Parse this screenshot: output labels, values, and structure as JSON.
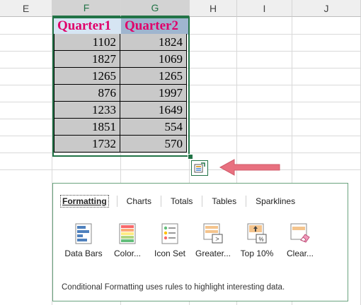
{
  "columns": {
    "E": "E",
    "F": "F",
    "G": "G",
    "H": "H",
    "I": "I",
    "J": "J"
  },
  "table": {
    "headers": [
      "Quarter1",
      "Quarter2"
    ],
    "rows": [
      [
        "1102",
        "1824"
      ],
      [
        "1827",
        "1069"
      ],
      [
        "1265",
        "1265"
      ],
      [
        "876",
        "1997"
      ],
      [
        "1233",
        "1649"
      ],
      [
        "1851",
        "554"
      ],
      [
        "1732",
        "570"
      ]
    ]
  },
  "quick_analysis": {
    "tabs": [
      "Formatting",
      "Charts",
      "Totals",
      "Tables",
      "Sparklines"
    ],
    "active_tab": "Formatting",
    "options": [
      {
        "label": "Data Bars",
        "icon": "data-bars-icon"
      },
      {
        "label": "Color...",
        "icon": "color-scale-icon"
      },
      {
        "label": "Icon Set",
        "icon": "icon-set-icon"
      },
      {
        "label": "Greater...",
        "icon": "greater-than-icon"
      },
      {
        "label": "Top 10%",
        "icon": "top-10-icon"
      },
      {
        "label": "Clear...",
        "icon": "clear-format-icon"
      }
    ],
    "footnote": "Conditional Formatting uses rules to highlight interesting data."
  },
  "colors": {
    "accent": "#217346",
    "header_text": "#e0006a",
    "arrow": "#e8707f"
  }
}
